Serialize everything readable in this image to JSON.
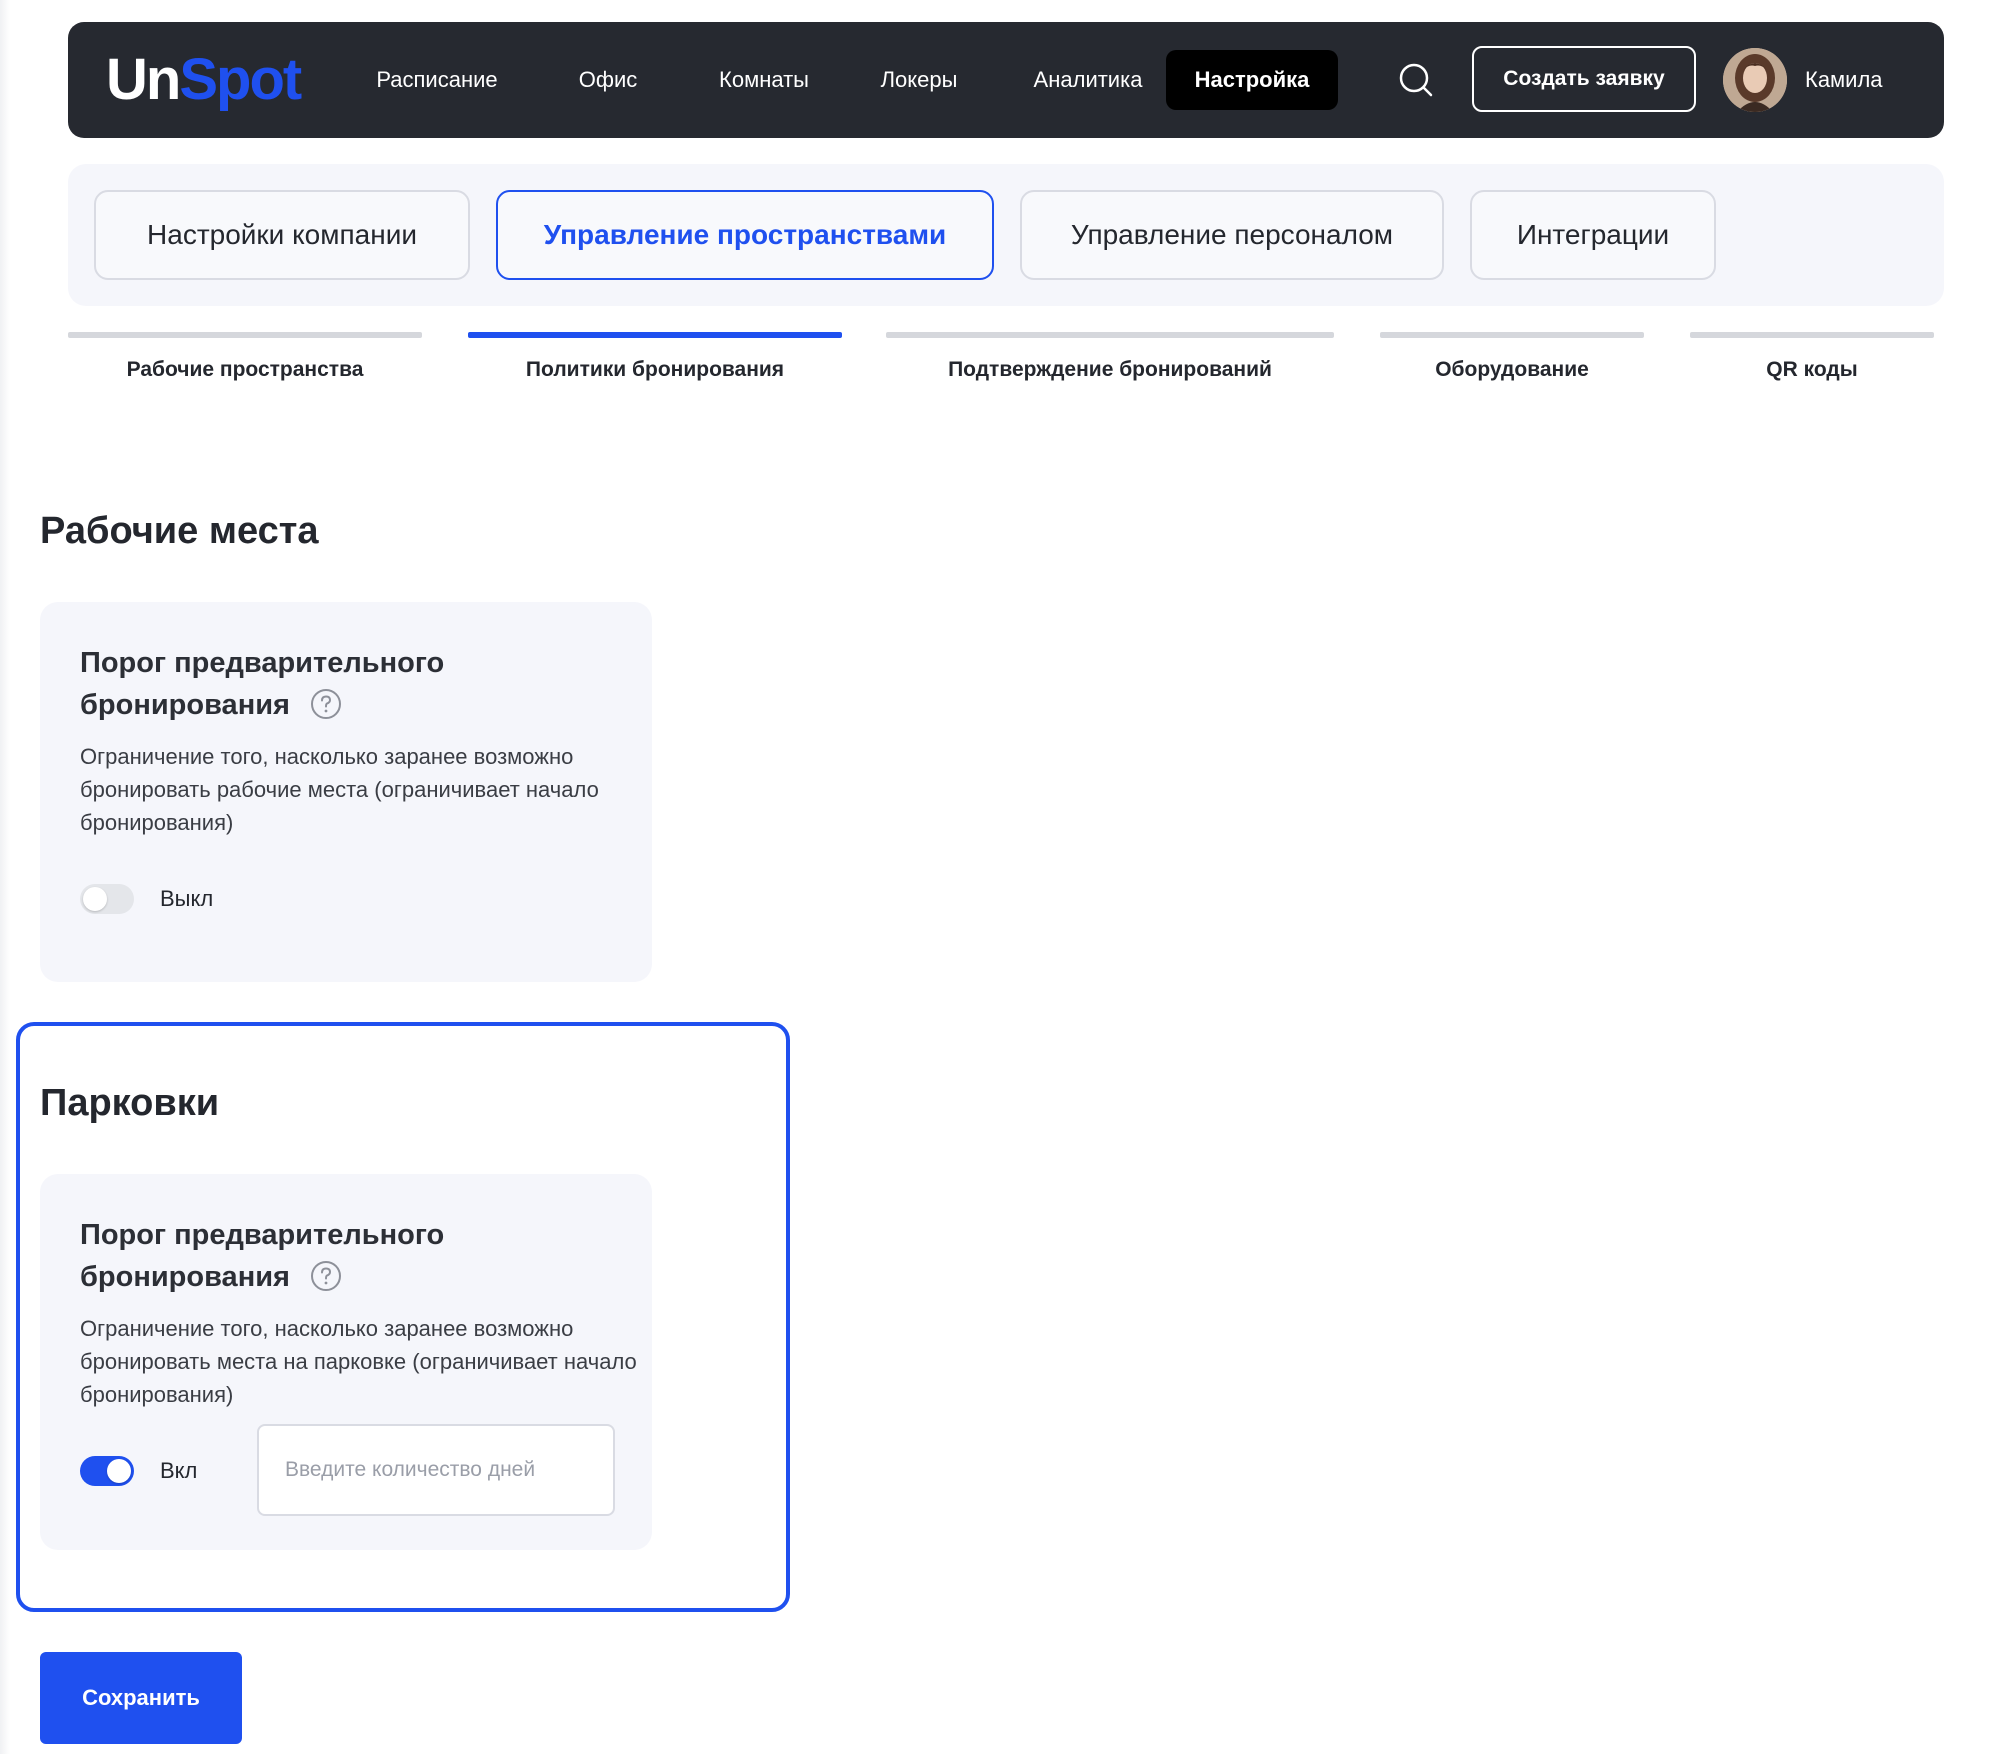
{
  "header": {
    "logo_part1": "Un",
    "logo_part2": "Spot",
    "nav": [
      {
        "label": "Расписание"
      },
      {
        "label": "Офис"
      },
      {
        "label": "Комнаты"
      },
      {
        "label": "Локеры"
      },
      {
        "label": "Аналитика"
      },
      {
        "label": "Настройка",
        "active": true
      }
    ],
    "create_button": "Создать заявку",
    "user_name": "Камила",
    "search_icon": "search-icon"
  },
  "main_tabs": [
    {
      "label": "Настройки компании"
    },
    {
      "label": "Управление пространствами",
      "active": true
    },
    {
      "label": "Управление персоналом"
    },
    {
      "label": "Интеграции"
    }
  ],
  "sub_tabs": [
    {
      "label": "Рабочие пространства"
    },
    {
      "label": "Политики бронирования",
      "active": true
    },
    {
      "label": "Подтверждение бронирований"
    },
    {
      "label": "Оборудование"
    },
    {
      "label": "QR коды"
    }
  ],
  "workplaces": {
    "title": "Рабочие места",
    "card": {
      "title_line1": "Порог предварительного",
      "title_line2": "бронирования",
      "description": "Ограничение того, насколько заранее возможно бронировать рабочие места (ограничивает начало бронирования)",
      "toggle_state": "off",
      "toggle_label": "Выкл"
    }
  },
  "parking": {
    "title": "Парковки",
    "card": {
      "title_line1": "Порог предварительного",
      "title_line2": "бронирования",
      "description": "Ограничение того, насколько заранее возможно бронировать места на парковке (ограничивает начало бронирования)",
      "toggle_state": "on",
      "toggle_label": "Вкл",
      "days_input_value": "",
      "days_input_placeholder": "Введите количество дней"
    }
  },
  "save_button": "Сохранить",
  "colors": {
    "accent": "#1f50ef",
    "topbar": "#262930",
    "panel": "#f5f6fb"
  }
}
